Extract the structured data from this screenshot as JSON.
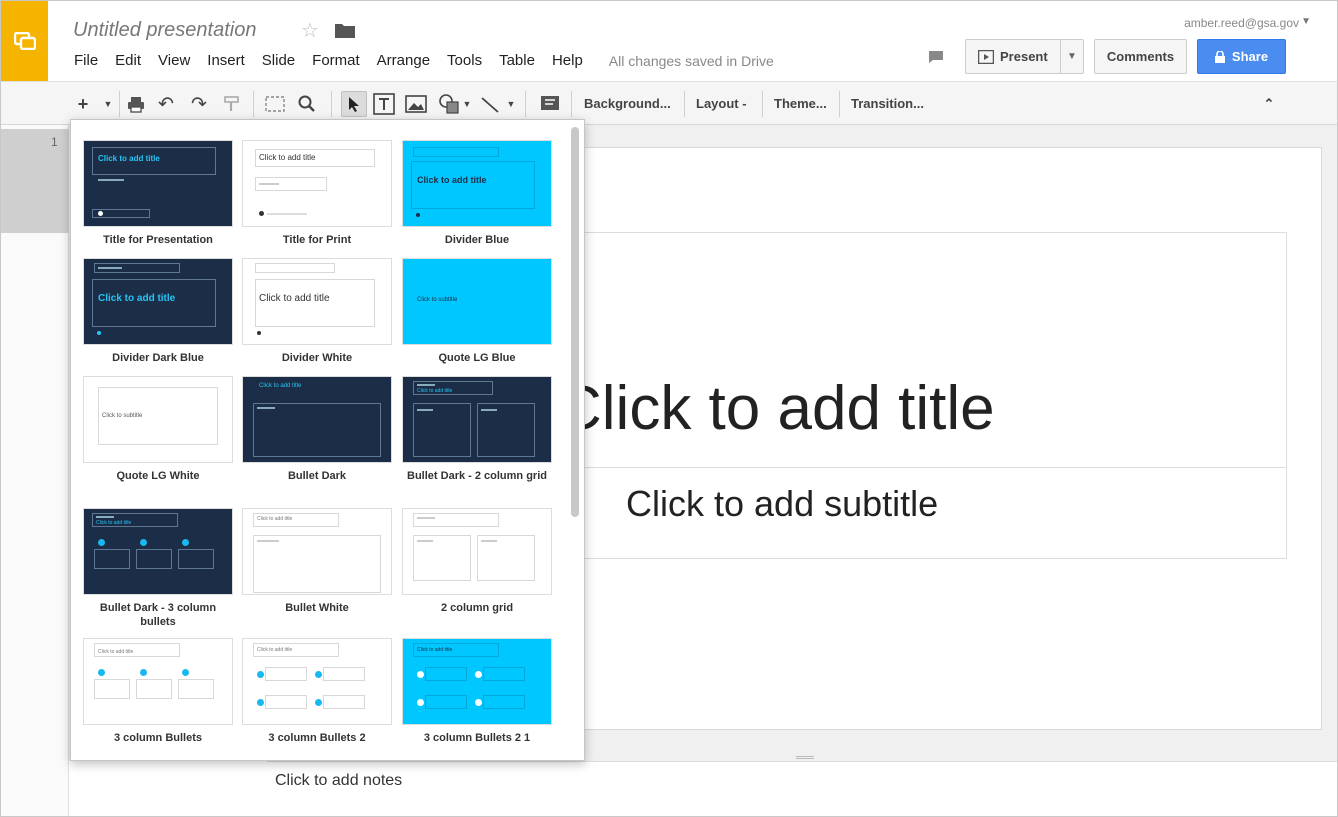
{
  "app": {
    "doc_title": "Untitled presentation",
    "account": "amber.reed@gsa.gov",
    "save_status": "All changes saved in Drive"
  },
  "menu": [
    "File",
    "Edit",
    "View",
    "Insert",
    "Slide",
    "Format",
    "Arrange",
    "Tools",
    "Table",
    "Help"
  ],
  "buttons": {
    "present": "Present",
    "comments": "Comments",
    "share": "Share"
  },
  "toolbar": {
    "background": "Background...",
    "layout": "Layout -",
    "theme": "Theme...",
    "transition": "Transition..."
  },
  "filmstrip": {
    "slide_number": "1"
  },
  "slide": {
    "title_placeholder": "Click to add title",
    "subtitle_placeholder": "Click to add subtitle"
  },
  "notes": {
    "placeholder": "Click to add notes"
  },
  "layouts": [
    {
      "name": "Title for Presentation",
      "style": "dark"
    },
    {
      "name": "Title for Print",
      "style": "white"
    },
    {
      "name": "Divider Blue",
      "style": "blue"
    },
    {
      "name": "Divider Dark Blue",
      "style": "dark"
    },
    {
      "name": "Divider White",
      "style": "white"
    },
    {
      "name": "Quote LG Blue",
      "style": "blue"
    },
    {
      "name": "Quote LG White",
      "style": "white"
    },
    {
      "name": "Bullet Dark",
      "style": "dark"
    },
    {
      "name": "Bullet Dark - 2 column grid",
      "style": "dark"
    },
    {
      "name": "Bullet Dark - 3 column bullets",
      "style": "dark"
    },
    {
      "name": "Bullet White",
      "style": "white"
    },
    {
      "name": "2 column grid",
      "style": "white"
    },
    {
      "name": "3 column Bullets",
      "style": "white"
    },
    {
      "name": "3 column Bullets 2",
      "style": "white"
    },
    {
      "name": "3 column Bullets 2 1",
      "style": "blue"
    }
  ],
  "thumb_text": {
    "click_to_add_title": "Click to add title",
    "click_to_subtitle": "Click to subtitle"
  },
  "colors": {
    "logo": "#f4b400",
    "share_button": "#4a8cf0",
    "layout_dark": "#1b2d47",
    "layout_blue": "#00c7ff",
    "thumb_title_cyan": "#27c4f4"
  },
  "icons": [
    "slides-logo-icon",
    "star-icon",
    "folder-icon",
    "chat-icon",
    "present-icon",
    "lock-icon",
    "new-slide-icon",
    "print-icon",
    "undo-icon",
    "redo-icon",
    "paint-format-icon",
    "fit-icon",
    "zoom-icon",
    "select-arrow-icon",
    "text-box-icon",
    "image-icon",
    "shape-icon",
    "line-icon",
    "comment-icon",
    "collapse-icon"
  ]
}
